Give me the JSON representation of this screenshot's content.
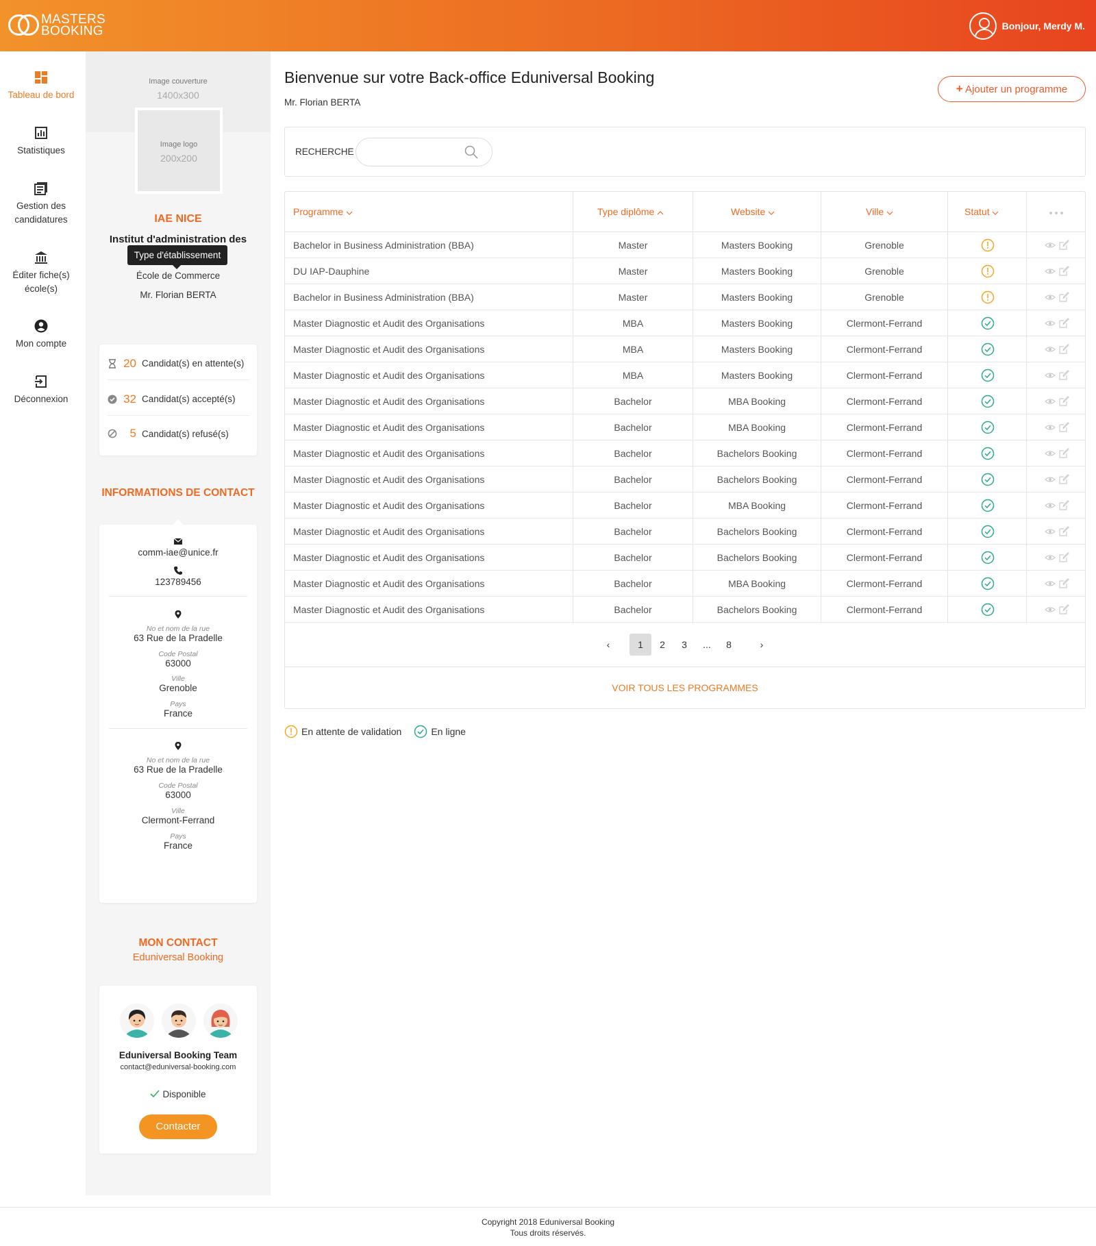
{
  "header": {
    "logo_line1": "MASTERS",
    "logo_line2": "BOOKING",
    "greeting": "Bonjour, Merdy M."
  },
  "nav": {
    "items": [
      {
        "label": "Tableau de bord",
        "icon": "dashboard-icon",
        "active": true
      },
      {
        "label": "Statistiques",
        "icon": "bar-chart-icon",
        "active": false
      },
      {
        "label": "Gestion des candidatures",
        "icon": "document-list-icon",
        "active": false
      },
      {
        "label": "Éditer fiche(s) école(s)",
        "icon": "institution-icon",
        "active": false
      },
      {
        "label": "Mon compte",
        "icon": "user-circle-icon",
        "active": false
      },
      {
        "label": "Déconnexion",
        "icon": "logout-icon",
        "active": false
      }
    ]
  },
  "school": {
    "cover_label": "Image couverture",
    "cover_dim": "1400x300",
    "logo_label": "Image logo",
    "logo_dim": "200x200",
    "name": "IAE NICE",
    "full_name": "Institut d'administration des",
    "tooltip": "Type d'établissement",
    "type": "École de Commerce",
    "contact_person": "Mr. Florian BERTA"
  },
  "stats": [
    {
      "icon": "hourglass-icon",
      "value": "20",
      "label": "Candidat(s) en attente(s)"
    },
    {
      "icon": "check-circle-icon",
      "value": "32",
      "label": "Candidat(s) accepté(s)"
    },
    {
      "icon": "ban-icon",
      "value": "5",
      "label": "Candidat(s) refusé(s)"
    }
  ],
  "contact_info": {
    "title": "INFORMATIONS DE CONTACT",
    "email": "comm-iae@unice.fr",
    "phone": "123789456",
    "addresses": [
      {
        "street_label": "No et nom de la rue",
        "street": "63 Rue de la Pradelle",
        "zip_label": "Code Postal",
        "zip": "63000",
        "city_label": "Ville",
        "city": "Grenoble",
        "country_label": "Pays",
        "country": "France"
      },
      {
        "street_label": "No et nom de la rue",
        "street": "63 Rue de la Pradelle",
        "zip_label": "Code Postal",
        "zip": "63000",
        "city_label": "Ville",
        "city": "Clermont-Ferrand",
        "country_label": "Pays",
        "country": "France"
      }
    ]
  },
  "my_contact": {
    "title": "MON CONTACT",
    "subtitle": "Eduniversal Booking",
    "team": "Eduniversal Booking Team",
    "email": "contact@eduniversal-booking.com",
    "availability": "Disponible",
    "button": "Contacter"
  },
  "main": {
    "title": "Bienvenue sur votre Back-office Eduniversal Booking",
    "subtitle": "Mr. Florian BERTA",
    "add_button": "Ajouter un programme",
    "search_label": "RECHERCHE",
    "search_value": "",
    "columns": [
      "Programme",
      "Type diplôme",
      "Website",
      "Ville",
      "Statut"
    ],
    "rows": [
      {
        "programme": "Bachelor in Business Administration (BBA)",
        "type": "Master",
        "website": "Masters Booking",
        "ville": "Grenoble",
        "status": "pending"
      },
      {
        "programme": "DU IAP-Dauphine",
        "type": "Master",
        "website": "Masters Booking",
        "ville": "Grenoble",
        "status": "pending"
      },
      {
        "programme": "Bachelor in Business Administration (BBA)",
        "type": "Master",
        "website": "Masters Booking",
        "ville": "Grenoble",
        "status": "pending"
      },
      {
        "programme": "Master Diagnostic et Audit des Organisations",
        "type": "MBA",
        "website": "Masters Booking",
        "ville": "Clermont-Ferrand",
        "status": "online"
      },
      {
        "programme": "Master Diagnostic et Audit des Organisations",
        "type": "MBA",
        "website": "Masters Booking",
        "ville": "Clermont-Ferrand",
        "status": "online"
      },
      {
        "programme": "Master Diagnostic et Audit des Organisations",
        "type": "MBA",
        "website": "Masters Booking",
        "ville": "Clermont-Ferrand",
        "status": "online"
      },
      {
        "programme": "Master Diagnostic et Audit des Organisations",
        "type": "Bachelor",
        "website": "MBA Booking",
        "ville": "Clermont-Ferrand",
        "status": "online"
      },
      {
        "programme": "Master Diagnostic et Audit des Organisations",
        "type": "Bachelor",
        "website": "MBA Booking",
        "ville": "Clermont-Ferrand",
        "status": "online"
      },
      {
        "programme": "Master Diagnostic et Audit des Organisations",
        "type": "Bachelor",
        "website": "Bachelors Booking",
        "ville": "Clermont-Ferrand",
        "status": "online"
      },
      {
        "programme": "Master Diagnostic et Audit des Organisations",
        "type": "Bachelor",
        "website": "Bachelors Booking",
        "ville": "Clermont-Ferrand",
        "status": "online"
      },
      {
        "programme": "Master Diagnostic et Audit des Organisations",
        "type": "Bachelor",
        "website": "MBA Booking",
        "ville": "Clermont-Ferrand",
        "status": "online"
      },
      {
        "programme": "Master Diagnostic et Audit des Organisations",
        "type": "Bachelor",
        "website": "Bachelors Booking",
        "ville": "Clermont-Ferrand",
        "status": "online"
      },
      {
        "programme": "Master Diagnostic et Audit des Organisations",
        "type": "Bachelor",
        "website": "Bachelors Booking",
        "ville": "Clermont-Ferrand",
        "status": "online"
      },
      {
        "programme": "Master Diagnostic et Audit des Organisations",
        "type": "Bachelor",
        "website": "MBA Booking",
        "ville": "Clermont-Ferrand",
        "status": "online"
      },
      {
        "programme": "Master Diagnostic et Audit des Organisations",
        "type": "Bachelor",
        "website": "Bachelors Booking",
        "ville": "Clermont-Ferrand",
        "status": "online"
      }
    ],
    "pagination": {
      "prev": "‹",
      "pages": [
        "1",
        "2",
        "3",
        "...",
        "8"
      ],
      "current": "1",
      "next": "›"
    },
    "see_all": "VOIR TOUS LES PROGRAMMES",
    "legend": {
      "pending": "En attente de validation",
      "online": "En ligne"
    }
  },
  "colors": {
    "accent": "#ee6a22",
    "pending": "#f5a623",
    "online": "#2bab8e"
  },
  "footer": {
    "line1": "Copyright 2018 Eduniversal Booking",
    "line2": "Tous droits réservés."
  }
}
